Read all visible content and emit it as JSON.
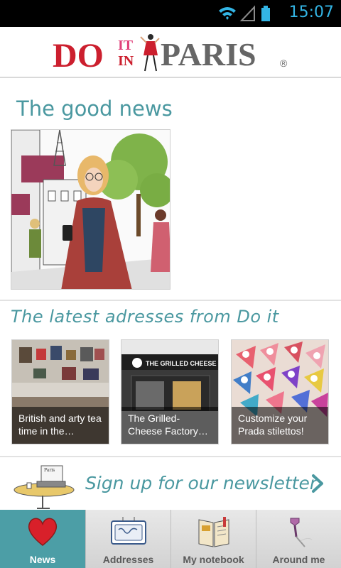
{
  "status_bar": {
    "time": "15:07"
  },
  "header": {
    "logo_text_do": "DO",
    "logo_text_it": "IT",
    "logo_text_in": "IN",
    "logo_text_paris": "PARIS",
    "logo_mark": "®"
  },
  "good_news": {
    "title": "The good news"
  },
  "latest": {
    "title": "The latest adresses from Do it",
    "cards": [
      {
        "caption": "British and arty tea time in the…"
      },
      {
        "caption": "The Grilled-Cheese Factory…",
        "sign": "THE GRILLED CHEESE FACTORY"
      },
      {
        "caption": "Customize your Prada stilettos!"
      }
    ]
  },
  "newsletter": {
    "label": "Sign up for our newsletter",
    "sign_text": "Paris"
  },
  "tabs": [
    {
      "label": "News",
      "active": true
    },
    {
      "label": "Addresses",
      "active": false
    },
    {
      "label": "My notebook",
      "active": false
    },
    {
      "label": "Around me",
      "active": false
    }
  ],
  "colors": {
    "accent": "#4a98a0",
    "tab_active": "#4c9ea6",
    "logo_red": "#cc1f2e",
    "logo_gray": "#666666",
    "status_blue": "#33b5e5"
  }
}
